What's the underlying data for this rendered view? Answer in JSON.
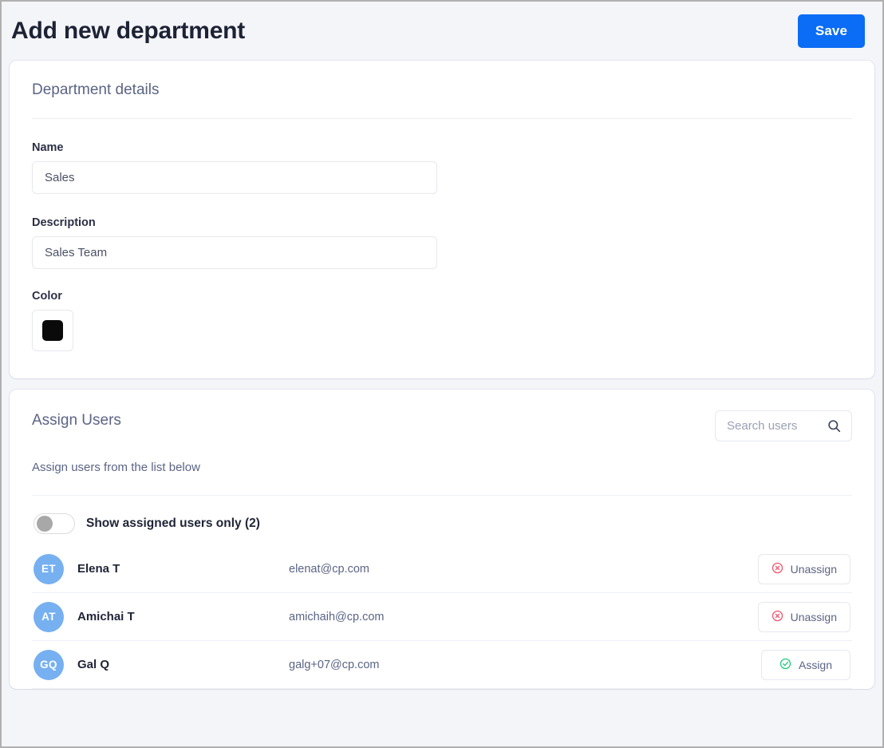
{
  "header": {
    "title": "Add new department",
    "save_label": "Save"
  },
  "details_card": {
    "section_title": "Department details",
    "fields": [
      {
        "label": "Name",
        "value": "Sales",
        "placeholder": "Name"
      },
      {
        "label": "Description",
        "value": "Sales Team",
        "placeholder": "Description"
      }
    ],
    "color": {
      "label": "Color",
      "value": "#0a0a0a"
    }
  },
  "assign_card": {
    "section_title": "Assign Users",
    "subtitle": "Assign users from the list below",
    "search": {
      "placeholder": "Search users",
      "value": "",
      "icon": "search-icon"
    },
    "toggle": {
      "label": "Show assigned users only (2)",
      "state": "off"
    },
    "actions": {
      "unassign_label": "Unassign",
      "assign_label": "Assign",
      "unassign_icon": "circle-x-icon",
      "assign_icon": "circle-check-icon",
      "unassign_color": "#f2536d",
      "assign_color": "#21c97a"
    },
    "users": [
      {
        "initials": "ET",
        "name": "Elena T",
        "email": "elenat@cp.com",
        "action": "Unassign"
      },
      {
        "initials": "AT",
        "name": "Amichai T",
        "email": "amichaih@cp.com",
        "action": "Unassign"
      },
      {
        "initials": "GQ",
        "name": "Gal Q",
        "email": "galg+07@cp.com",
        "action": "Assign"
      }
    ]
  },
  "theme": {
    "accent": "#0b6cf5",
    "background": "#f4f5f9",
    "avatar": "#76b0f0"
  }
}
